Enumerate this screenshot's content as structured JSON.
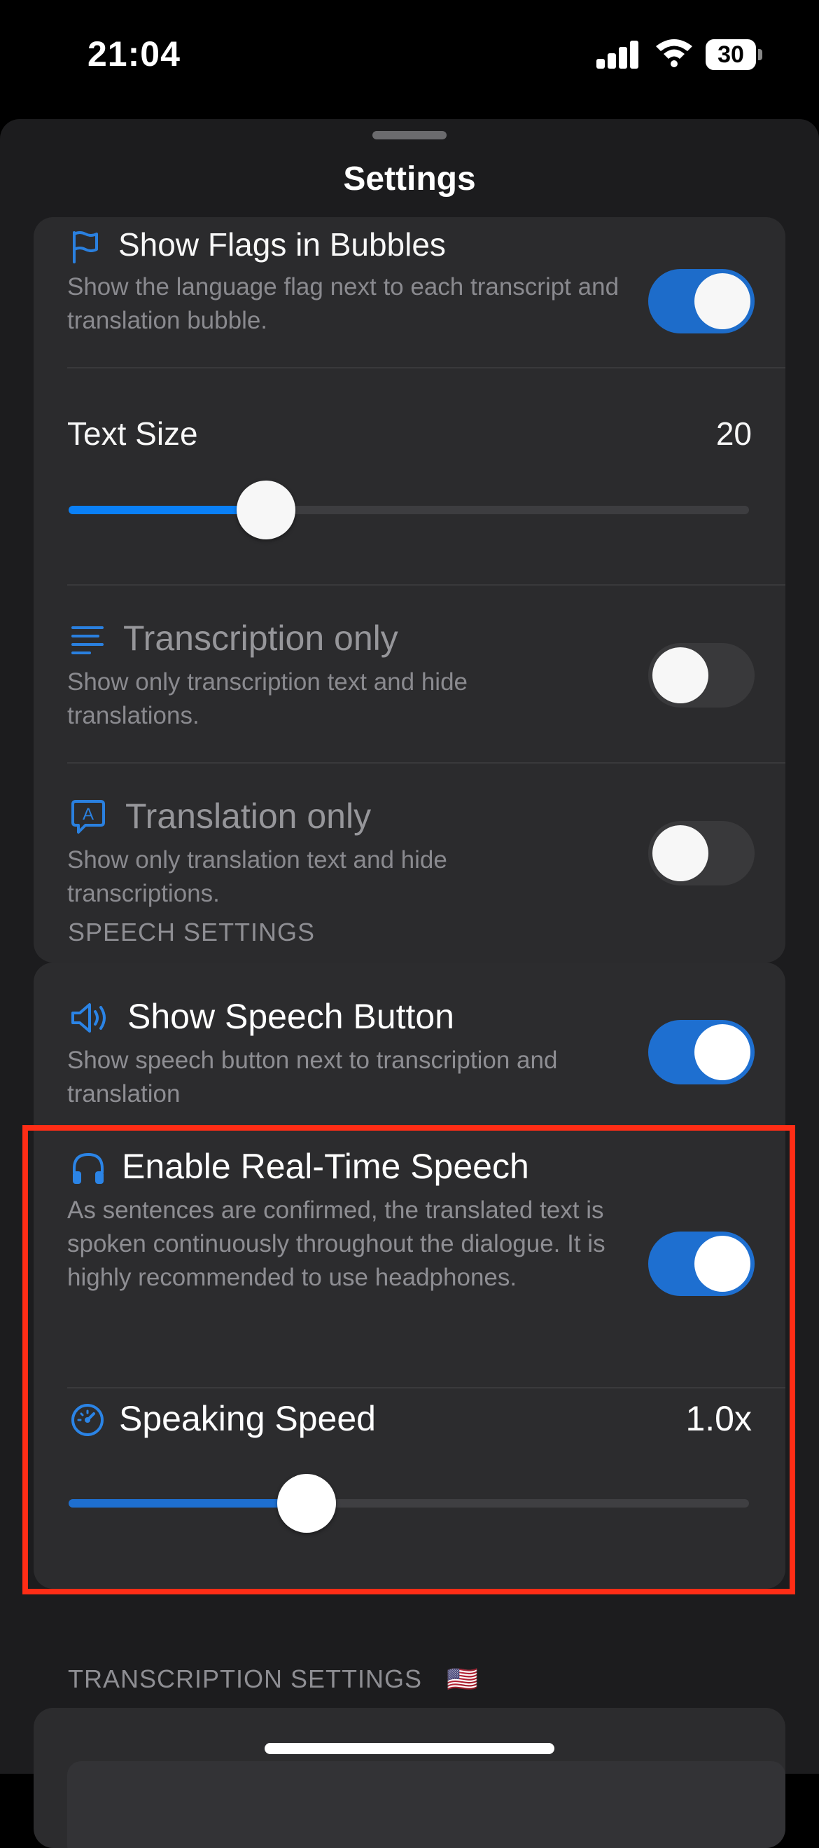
{
  "status_bar": {
    "time": "21:04",
    "battery": "30"
  },
  "sheet": {
    "title": "Settings"
  },
  "display_card": {
    "show_flags": {
      "title": "Show Flags in Bubbles",
      "description": "Show the language flag next to each transcript and translation bubble.",
      "on": true
    },
    "text_size": {
      "title": "Text Size",
      "value": "20",
      "fraction": 0.29
    },
    "transcription_only": {
      "title": "Transcription only",
      "description": "Show only transcription text and hide translations.",
      "on": false
    },
    "translation_only": {
      "title": "Translation only",
      "description": "Show only translation text and hide transcriptions.",
      "on": false
    }
  },
  "speech_section": {
    "header": "SPEECH SETTINGS",
    "show_speech_button": {
      "title": "Show Speech Button",
      "description": "Show speech button next to transcription and translation",
      "on": true
    },
    "realtime_speech": {
      "title": "Enable Real-Time Speech",
      "description": "As sentences are confirmed, the translated text is spoken continuously throughout the dialogue. It is highly recommended to use headphones.",
      "on": true
    },
    "speaking_speed": {
      "title": "Speaking Speed",
      "value": "1.0x",
      "fraction": 0.35
    }
  },
  "transcription_section": {
    "header": "TRANSCRIPTION SETTINGS",
    "flag": "🇺🇸"
  },
  "colors": {
    "accent": "#1e6fd0",
    "slider_fill": "#0a84ff",
    "highlight": "#ff2d16"
  },
  "icons": [
    "flag-icon",
    "text-lines-icon",
    "translate-bubble-icon",
    "speaker-icon",
    "headphones-icon",
    "speedometer-icon"
  ]
}
